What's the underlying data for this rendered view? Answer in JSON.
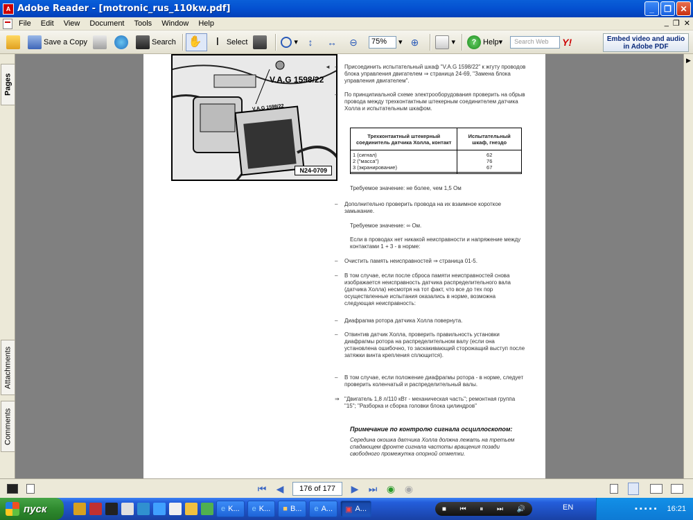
{
  "window": {
    "title": "Adobe Reader - [motronic_rus_110kw.pdf]",
    "app_icon": "pdf"
  },
  "menu": [
    "File",
    "Edit",
    "View",
    "Document",
    "Tools",
    "Window",
    "Help"
  ],
  "toolbar": {
    "save_copy": "Save a Copy",
    "search": "Search",
    "select": "Select",
    "zoom": "75%",
    "help": "Help",
    "search_web_placeholder": "Search Web",
    "embed": "Embed video and audio in Adobe PDF"
  },
  "nav_tabs": {
    "pages": "Pages",
    "attachments": "Attachments",
    "comments": "Comments"
  },
  "figure": {
    "label": "V.A.G 1598/22",
    "connector_label": "V.A.G 1598/22",
    "id": "N24-0709"
  },
  "document": {
    "para1": "Присоединить испытательный шкаф \"V.A.G 1598/22\" к жгуту проводов блока управления двигателем ⇒ страница 24-69, \"Замена блока управления двигателем\".",
    "para2": "По принципиальной схеме электрооборудования проверить на обрыв провода между трехконтактным штекерным соединителем датчика Холла и испытательным шкафом.",
    "table": {
      "headers": [
        "Трехконтактный штекерный соединитель датчика Холла, контакт",
        "Испытательный шкаф, гнездо"
      ],
      "rows": [
        [
          "1 (сигнал)",
          "62"
        ],
        [
          "2 (\"масса\")",
          "76"
        ],
        [
          "3 (экранирование)",
          "67"
        ]
      ]
    },
    "req1": "Требуемое значение: не более, чем 1,5 Ом",
    "para3": "Дополнительно проверить провода на их взаимное короткое замыкание.",
    "req2": "Требуемое значение: ∞ Ом.",
    "para4": "Если в проводах нет никакой неисправности и напряжение между контактами 1 + 3 - в норме:",
    "para5": "Очистить память неисправностей ⇒ страница 01-5.",
    "para6": "В том случае, если после сброса памяти неисправностей снова изображается неисправность датчика распределительного вала (датчика Холла) несмотря на тот факт, что все до тех пор осуществленные испытания оказались в норме, возможна следующая неисправность:",
    "para7": "Диафрагма ротора датчика Холла повернута.",
    "para8": "Отвинтив датчик Холла, проверить правильность установки диафрагмы ротора на распределительном валу (если она установлена ошибочно, то заскакивающий сторожащий выступ после затяжки винта крепления сплющится).",
    "para9": "В том случае, если положение диафрагмы ротора - в норме, следует проверить коленчатый и распределительный валы.",
    "para10": "\"Двигатель 1,8 л/110 кВт - механическая часть\"; ремонтная группа \"15\"; \"Разборка и сборка головки блока цилиндров\"",
    "note_title": "Примечание по контролю сигнала осциллоскопом:",
    "note_body": "Середина окошка датчика Холла должна лежать на третьем спадающем фронте сигнала частоты вращения позади свободного промежутка опорной отметки."
  },
  "status": {
    "page_field": "176 of 177"
  },
  "taskbar": {
    "start": "пуск",
    "tasks": [
      "K...",
      "K...",
      "B...",
      "A...",
      "A..."
    ],
    "lang": "EN",
    "clock": "16:21"
  }
}
